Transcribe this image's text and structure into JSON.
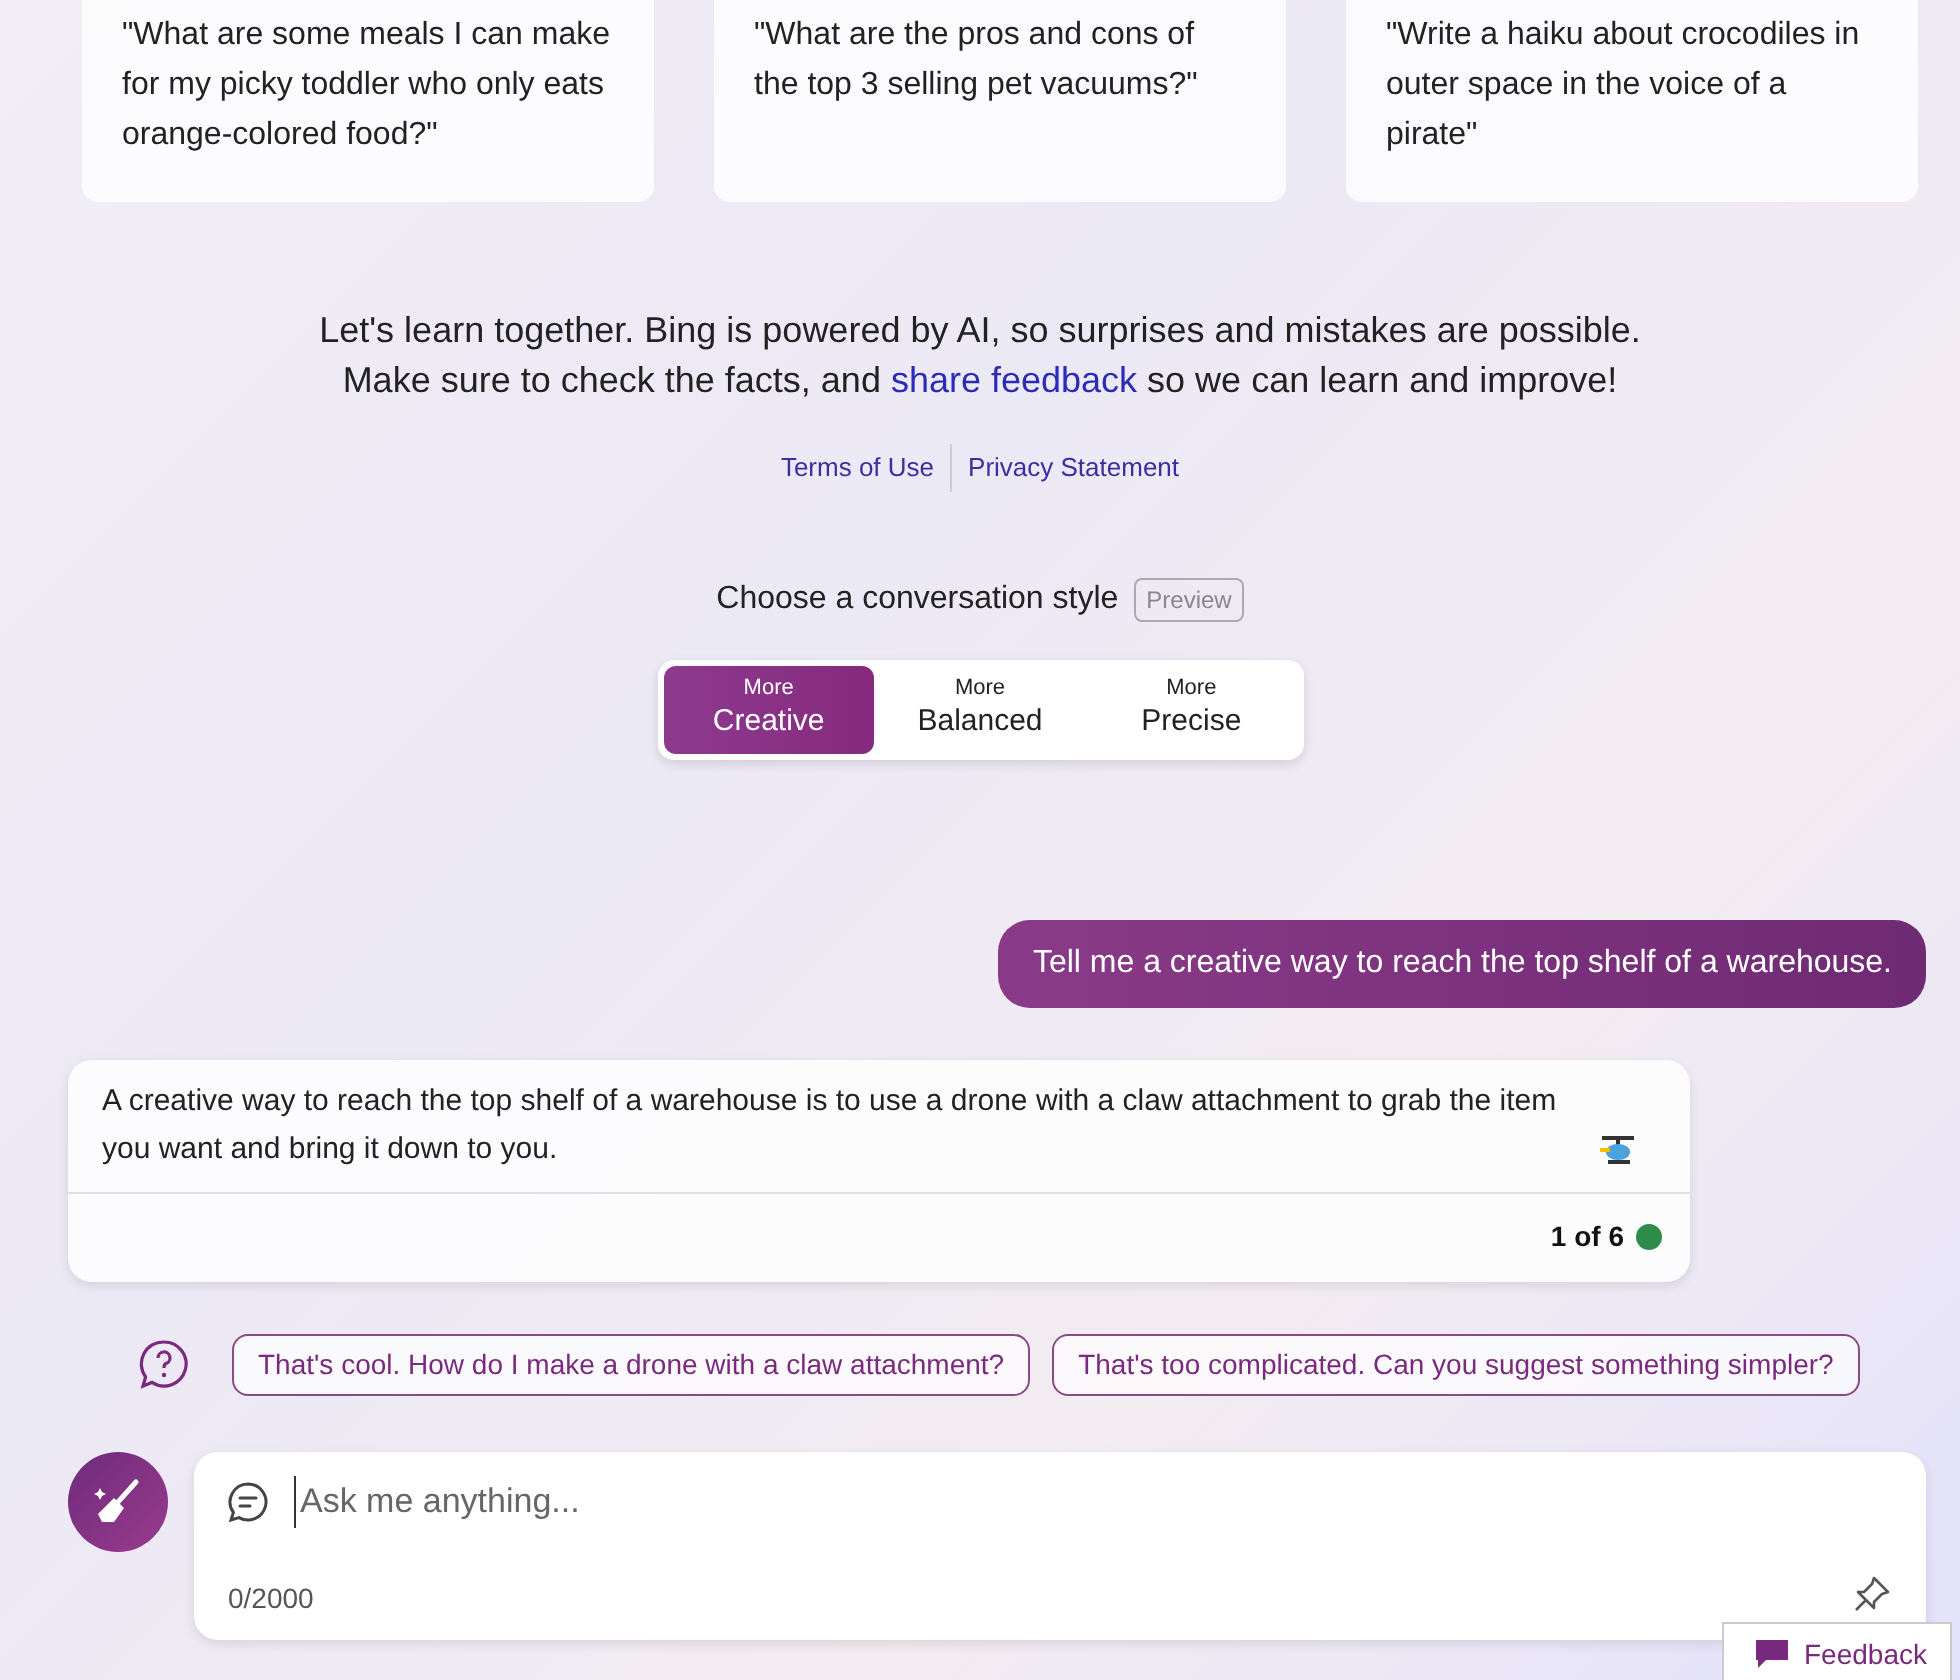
{
  "prompt_cards": [
    "\"What are some meals I can make for my picky toddler who only eats orange-colored food?\"",
    "\"What are the pros and cons of the top 3 selling pet vacuums?\"",
    "\"Write a haiku about crocodiles in outer space in the voice of a pirate\""
  ],
  "disclaimer": {
    "line_1": "Let's learn together. Bing is powered by AI, so surprises and mistakes are possible.",
    "line_2_before": "Make sure to check the facts, and",
    "link": "share feedback",
    "line_2_after": "so we can learn and improve!"
  },
  "legal_links": [
    "Terms of Use",
    "Privacy Statement"
  ],
  "conversation_style": {
    "label": "Choose a conversation style",
    "badge": "Preview",
    "options": [
      {
        "prefix": "More",
        "label": "Creative",
        "selected": true
      },
      {
        "prefix": "More",
        "label": "Balanced",
        "selected": false
      },
      {
        "prefix": "More",
        "label": "Precise",
        "selected": false
      }
    ]
  },
  "messages": [
    {
      "kind": "user",
      "text": "Tell me a creative way to reach the top shelf of a warehouse."
    },
    {
      "kind": "bot",
      "text": "A creative way to reach the top shelf of a warehouse is to use a drone with a claw attachment to grab the item you want and bring it down to you.",
      "counter": "1 of 6"
    }
  ],
  "suggestions": [
    "That's cool. How do I make a drone with a claw attachment?",
    "That's too complicated. Can you suggest something simpler?"
  ],
  "input": {
    "placeholder": "Ask me anything...",
    "char_count": "0/2000"
  },
  "feedback_button": "Feedback"
}
